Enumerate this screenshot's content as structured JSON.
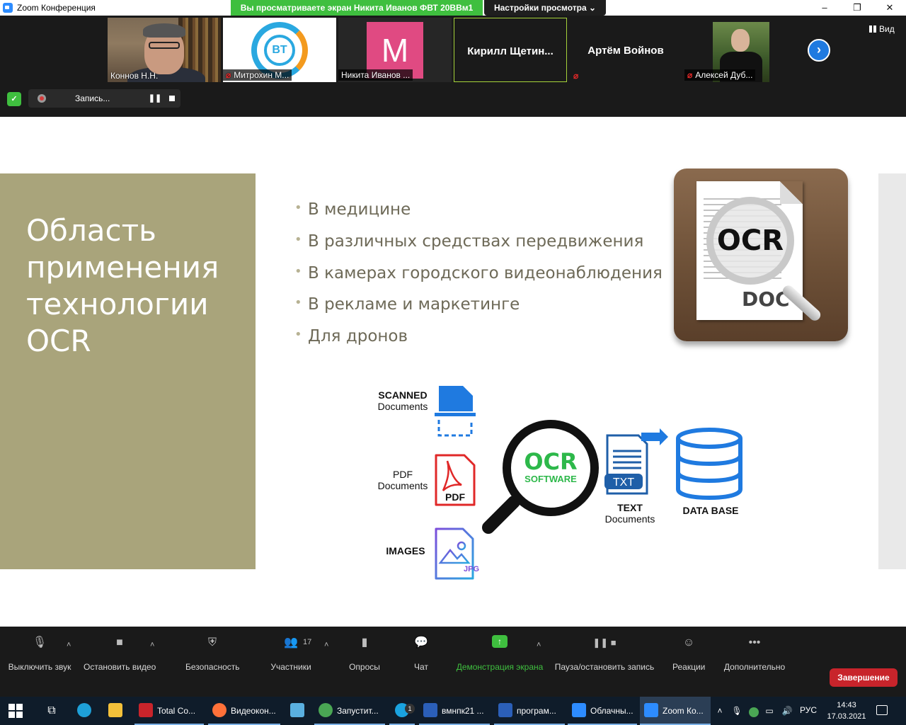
{
  "window": {
    "title": "Zoom Конференция",
    "share_banner": "Вы просматриваете экран Никита Иванов ФВТ 20ВВм1",
    "view_settings": "Настройки просмотра",
    "controls": [
      "–",
      "❐",
      "✕"
    ]
  },
  "participants": [
    {
      "name": "Коннов Н.Н.",
      "muted": false
    },
    {
      "name": "Митрохин М...",
      "muted": true
    },
    {
      "name": "Никита Иванов ...",
      "muted": false,
      "avatar_letter": "M",
      "avatar_color": "#e04a82"
    },
    {
      "name": "Кирилл  Щетин...",
      "muted": false,
      "active": true
    },
    {
      "name": "Артём Войнов",
      "muted": true
    },
    {
      "name": "Алексей Дуб...",
      "muted": true
    }
  ],
  "strip": {
    "view_label": "Вид",
    "recording_label": "Запись...",
    "bt_logo_text": "BT"
  },
  "slide": {
    "title": "Область применения технологии OCR",
    "bullets": [
      "В медицине",
      "В различных средствах передвижения",
      "В камерах городского видеонаблюдения",
      "В рекламе и маркетинге",
      "Для дронов"
    ],
    "ocr_icon": {
      "glass_text": "OCR",
      "doc_text": "DOC"
    },
    "flow": {
      "scanned_line1": "SCANNED",
      "scanned_line2": "Documents",
      "pdf_line1": "PDF",
      "pdf_line2": "Documents",
      "pdf_badge": "PDF",
      "images": "IMAGES",
      "jpg_badge": "JPG",
      "ocr_big": "OCR",
      "ocr_small": "SOFTWARE",
      "txt_badge": "TXT",
      "text_line1": "TEXT",
      "text_line2": "Documents",
      "database": "DATA BASE"
    },
    "accent_color": "#a9a47b"
  },
  "toolbar": {
    "items": [
      {
        "label": "Выключить звук",
        "icon": "microphone-icon"
      },
      {
        "label": "Остановить видео",
        "icon": "video-camera-icon"
      },
      {
        "label": "Безопасность",
        "icon": "shield-icon"
      },
      {
        "label": "Участники",
        "icon": "participants-icon",
        "count": "17"
      },
      {
        "label": "Опросы",
        "icon": "polls-icon"
      },
      {
        "label": "Чат",
        "icon": "chat-icon"
      },
      {
        "label": "Демонстрация экрана",
        "icon": "share-screen-icon"
      },
      {
        "label": "Пауза/остановить запись",
        "icon": "record-pause-icon"
      },
      {
        "label": "Реакции",
        "icon": "reactions-icon"
      },
      {
        "label": "Дополнительно",
        "icon": "more-icon"
      }
    ],
    "end_label": "Завершение"
  },
  "taskbar": {
    "apps": [
      {
        "label": "Total Co..."
      },
      {
        "label": "Видеокон..."
      },
      {
        "label": "Запустит..."
      },
      {
        "label": "вмнпк21 ..."
      },
      {
        "label": "програм..."
      },
      {
        "label": "Облачны..."
      },
      {
        "label": "Zoom Ко..."
      }
    ],
    "skype_badge": "1",
    "lang": "РУС",
    "time": "14:43",
    "date": "17.03.2021"
  }
}
